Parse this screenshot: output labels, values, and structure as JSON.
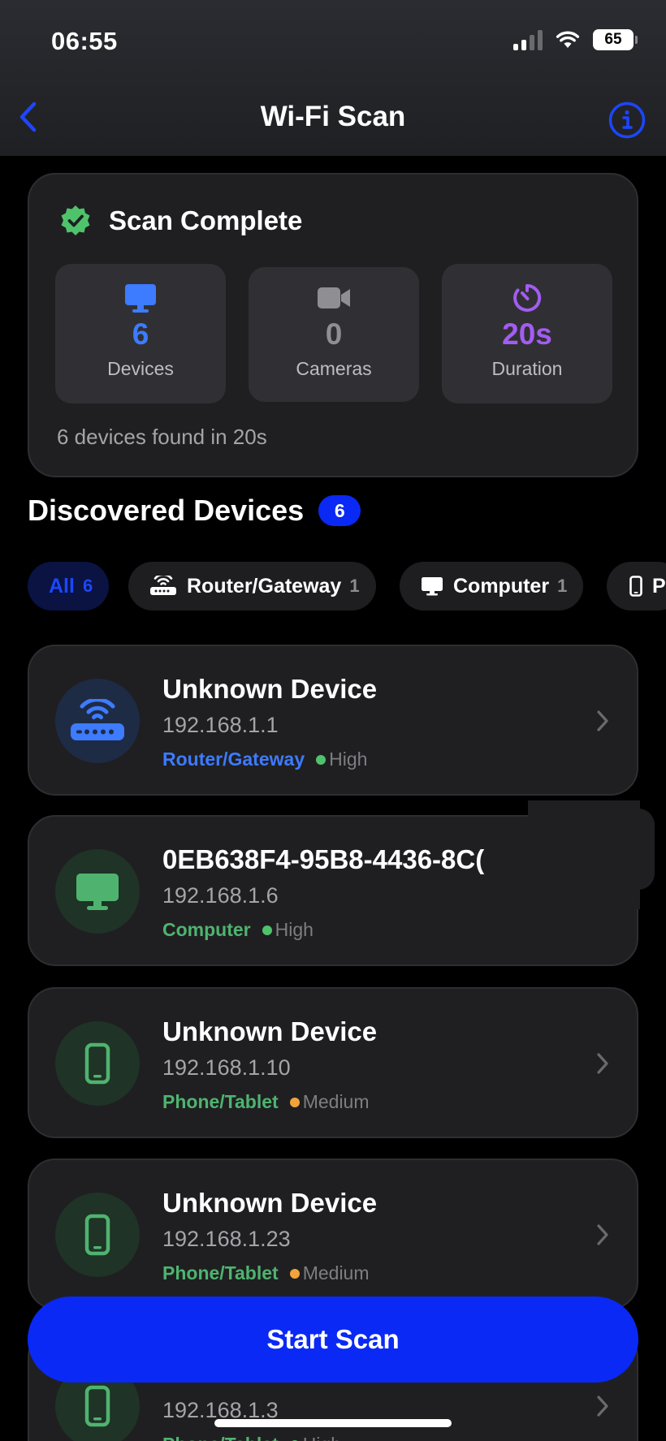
{
  "status_bar": {
    "time": "06:55",
    "battery": "65"
  },
  "nav": {
    "title": "Wi-Fi Scan"
  },
  "summary": {
    "title": "Scan Complete",
    "stats": [
      {
        "value": "6",
        "label": "Devices",
        "color": "#3d7bff",
        "icon": "monitor-icon"
      },
      {
        "value": "0",
        "label": "Cameras",
        "color": "#8e8e93",
        "icon": "video-camera-icon"
      },
      {
        "value": "20s",
        "label": "Duration",
        "color": "#a35cf0",
        "icon": "timer-icon"
      }
    ],
    "footer": "6 devices found in 20s"
  },
  "section": {
    "title": "Discovered Devices",
    "count": "6"
  },
  "filters": [
    {
      "label": "All",
      "count": "6",
      "active": true
    },
    {
      "label": "Router/Gateway",
      "count": "1",
      "icon": "router-icon"
    },
    {
      "label": "Computer",
      "count": "1",
      "icon": "monitor-icon"
    },
    {
      "label": "P",
      "count": "",
      "icon": "phone-icon"
    }
  ],
  "devices": [
    {
      "name": "Unknown Device",
      "ip": "192.168.1.1",
      "type": "Router/Gateway",
      "confidence": "High",
      "type_color": "#3d7bff",
      "dot_color": "#4fc36b",
      "icon": "router-icon"
    },
    {
      "name": "0EB638F4-95B8-4436-8C(",
      "ip": "192.168.1.6",
      "type": "Computer",
      "confidence": "High",
      "type_color": "#4fb36f",
      "dot_color": "#4fc36b",
      "icon": "monitor-icon"
    },
    {
      "name": "Unknown Device",
      "ip": "192.168.1.10",
      "type": "Phone/Tablet",
      "confidence": "Medium",
      "type_color": "#4fb36f",
      "dot_color": "#f2a33a",
      "icon": "phone-icon"
    },
    {
      "name": "Unknown Device",
      "ip": "192.168.1.23",
      "type": "Phone/Tablet",
      "confidence": "Medium",
      "type_color": "#4fb36f",
      "dot_color": "#f2a33a",
      "icon": "phone-icon"
    },
    {
      "name": "",
      "ip": "192.168.1.3",
      "type": "Phone/Tablet",
      "confidence": "High",
      "type_color": "#4fb36f",
      "dot_color": "#4fc36b",
      "icon": "phone-icon"
    }
  ],
  "start_button": {
    "label": "Start Scan"
  },
  "colors": {
    "accent": "#0a29f5",
    "card": "#1f1f22"
  }
}
